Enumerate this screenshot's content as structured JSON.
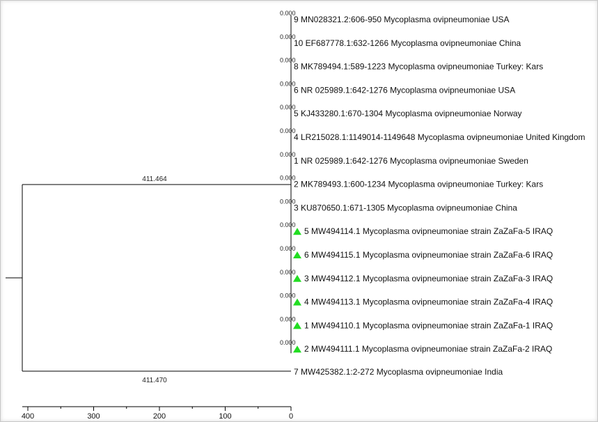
{
  "tree": {
    "leaves": [
      {
        "label": "9 MN028321.2:606-950 Mycoplasma ovipneumoniae USA",
        "branch_length": "0.000",
        "marker": false
      },
      {
        "label": "10 EF687778.1:632-1266 Mycoplasma ovipneumoniae China",
        "branch_length": "0.000",
        "marker": false
      },
      {
        "label": "8 MK789494.1:589-1223 Mycoplasma ovipneumoniae Turkey: Kars",
        "branch_length": "0.000",
        "marker": false
      },
      {
        "label": "6 NR 025989.1:642-1276 Mycoplasma ovipneumoniae USA",
        "branch_length": "0.000",
        "marker": false
      },
      {
        "label": "5 KJ433280.1:670-1304 Mycoplasma ovipneumoniae Norway",
        "branch_length": "0.000",
        "marker": false
      },
      {
        "label": "4 LR215028.1:1149014-1149648 Mycoplasma ovipneumoniae United Kingdom",
        "branch_length": "0.000",
        "marker": false
      },
      {
        "label": "1 NR 025989.1:642-1276 Mycoplasma ovipneumoniae Sweden",
        "branch_length": "0.000",
        "marker": false
      },
      {
        "label": "2 MK789493.1:600-1234 Mycoplasma ovipneumoniae Turkey: Kars",
        "branch_length": "0.000",
        "marker": false
      },
      {
        "label": "3 KU870650.1:671-1305 Mycoplasma ovipneumoniae China",
        "branch_length": "0.000",
        "marker": false
      },
      {
        "label": "5 MW494114.1 Mycoplasma ovipneumoniae strain ZaZaFa-5 IRAQ",
        "branch_length": "0.000",
        "marker": true
      },
      {
        "label": "6 MW494115.1 Mycoplasma ovipneumoniae strain ZaZaFa-6 IRAQ",
        "branch_length": "0.000",
        "marker": true
      },
      {
        "label": "3 MW494112.1 Mycoplasma ovipneumoniae strain ZaZaFa-3 IRAQ",
        "branch_length": "0.000",
        "marker": true
      },
      {
        "label": "4 MW494113.1 Mycoplasma ovipneumoniae strain ZaZaFa-4 IRAQ",
        "branch_length": "0.000",
        "marker": true
      },
      {
        "label": "1 MW494110.1 Mycoplasma ovipneumoniae strain ZaZaFa-1 IRAQ",
        "branch_length": "0.000",
        "marker": true
      },
      {
        "label": "2 MW494111.1 Mycoplasma ovipneumoniae strain ZaZaFa-2 IRAQ",
        "branch_length": "0.000",
        "marker": true
      }
    ],
    "outgroup": {
      "label": "7 MW425382.1:2-272 Mycoplasma ovipneumoniae India"
    },
    "clade_branch_length": "411.464",
    "outgroup_branch_length": "411.470",
    "scale_ticks": [
      "400",
      "300",
      "200",
      "100",
      "0"
    ],
    "marker_color": "#22dd22"
  }
}
